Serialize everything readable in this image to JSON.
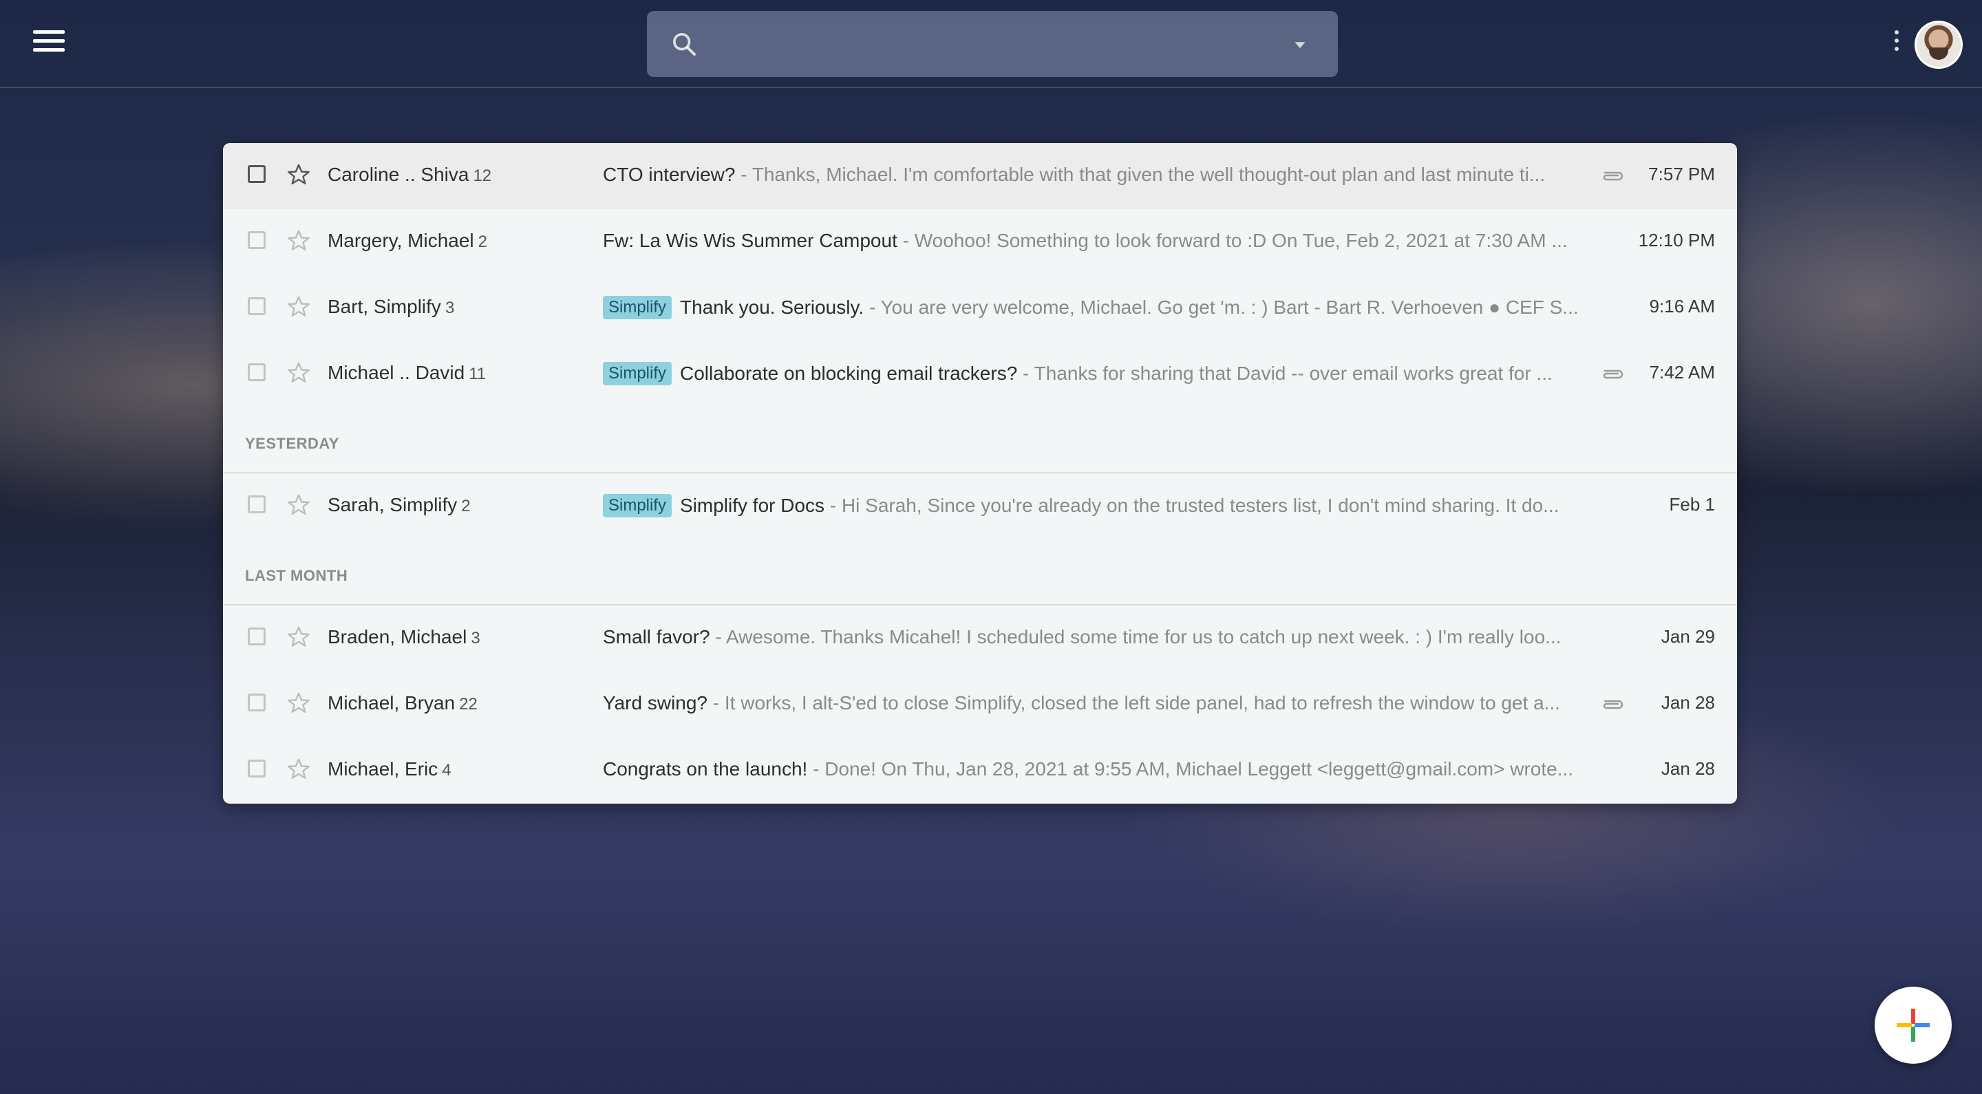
{
  "topbar": {
    "search": {
      "placeholder": "",
      "value": ""
    },
    "menu_icon": "hamburger-menu-icon",
    "options_icon": "vertical-dots-icon"
  },
  "sections": {
    "yesterday": "YESTERDAY",
    "last_month": "LAST MONTH"
  },
  "label_badge": "Simplify",
  "emails": [
    {
      "sender": "Caroline .. Shiva",
      "count": "12",
      "label": "",
      "subject": "CTO interview?",
      "snippet": " - Thanks, Michael. I'm comfortable with that given the well thought-out plan and last minute ti...",
      "attachment": true,
      "time": "7:57 PM",
      "selected": true
    },
    {
      "sender": "Margery, Michael",
      "count": "2",
      "label": "",
      "subject": "Fw: La Wis Wis Summer Campout",
      "snippet": " - Woohoo! Something to look forward to :D On Tue, Feb 2, 2021 at 7:30 AM ...",
      "attachment": false,
      "time": "12:10 PM",
      "selected": false
    },
    {
      "sender": "Bart, Simplify",
      "count": "3",
      "label": "Simplify",
      "subject": "Thank you. Seriously.",
      "snippet": " - You are very welcome, Michael. Go get 'm. : ) Bart - Bart R. Verhoeven ● CEF S...",
      "attachment": false,
      "time": "9:16 AM",
      "selected": false
    },
    {
      "sender": "Michael .. David",
      "count": "11",
      "label": "Simplify",
      "subject": "Collaborate on blocking email trackers?",
      "snippet": " - Thanks for sharing that David -- over email works great for ...",
      "attachment": true,
      "time": "7:42 AM",
      "selected": false
    },
    {
      "sender": "Sarah, Simplify",
      "count": "2",
      "label": "Simplify",
      "subject": "Simplify for Docs",
      "snippet": " - Hi Sarah, Since you're already on the trusted testers list, I don't mind sharing. It do...",
      "attachment": false,
      "time": "Feb 1",
      "selected": false
    },
    {
      "sender": "Braden, Michael",
      "count": "3",
      "label": "",
      "subject": "Small favor?",
      "snippet": " - Awesome. Thanks Micahel! I scheduled some time for us to catch up next week. : ) I'm really loo...",
      "attachment": false,
      "time": "Jan 29",
      "selected": false
    },
    {
      "sender": "Michael, Bryan",
      "count": "22",
      "label": "",
      "subject": "Yard swing?",
      "snippet": " - It works, I alt-S'ed to close Simplify, closed the left side panel, had to refresh the window to get a...",
      "attachment": true,
      "time": "Jan 28",
      "selected": false
    },
    {
      "sender": "Michael, Eric",
      "count": "4",
      "label": "",
      "subject": "Congrats on the launch!",
      "snippet": " - Done! On Thu, Jan 28, 2021 at 9:55 AM, Michael Leggett <leggett@gmail.com> wrote...",
      "attachment": false,
      "time": "Jan 28",
      "selected": false
    }
  ],
  "colors": {
    "badge_bg": "#8fd0df",
    "badge_text": "#12566a",
    "fab_plus": [
      "#ea4335",
      "#fbbc05",
      "#34a853",
      "#4285f4"
    ]
  }
}
